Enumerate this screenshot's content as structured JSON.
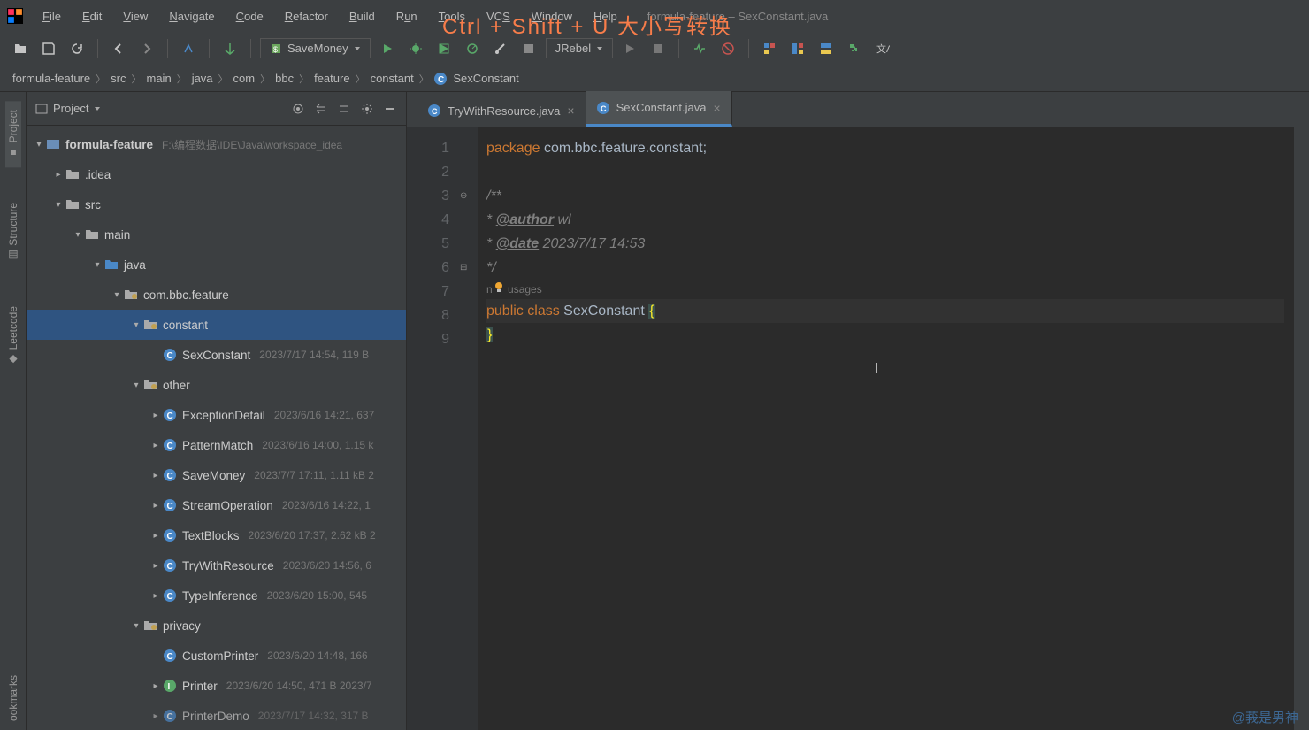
{
  "menu": [
    "File",
    "Edit",
    "View",
    "Navigate",
    "Code",
    "Refactor",
    "Build",
    "Run",
    "Tools",
    "VCS",
    "Window",
    "Help"
  ],
  "title_path": "formula-feature – SexConstant.java",
  "overlay": "Ctrl + Shift + U  大小写转换",
  "run_config": "SaveMoney",
  "jrebel": "JRebel",
  "breadcrumbs": [
    "formula-feature",
    "src",
    "main",
    "java",
    "com",
    "bbc",
    "feature",
    "constant",
    "SexConstant"
  ],
  "panel_name": "Project",
  "side_tabs": {
    "project": "Project",
    "structure": "Structure",
    "leetcode": "Leetcode",
    "bookmarks": "ookmarks"
  },
  "tree": {
    "root": {
      "name": "formula-feature",
      "meta": "F:\\编程数据\\IDE\\Java\\workspace_idea"
    },
    "idea": ".idea",
    "src": "src",
    "main": "main",
    "java": "java",
    "pkg": "com.bbc.feature",
    "constant": "constant",
    "sex": {
      "name": "SexConstant",
      "meta": "2023/7/17 14:54, 119 B"
    },
    "other": "other",
    "items": [
      {
        "name": "ExceptionDetail",
        "meta": "2023/6/16 14:21, 637"
      },
      {
        "name": "PatternMatch",
        "meta": "2023/6/16 14:00, 1.15 k"
      },
      {
        "name": "SaveMoney",
        "meta": "2023/7/7 17:11, 1.11 kB 2"
      },
      {
        "name": "StreamOperation",
        "meta": "2023/6/16 14:22, 1"
      },
      {
        "name": "TextBlocks",
        "meta": "2023/6/20 17:37, 2.62 kB 2"
      },
      {
        "name": "TryWithResource",
        "meta": "2023/6/20 14:56, 6"
      },
      {
        "name": "TypeInference",
        "meta": "2023/6/20 15:00, 545"
      }
    ],
    "privacy": "privacy",
    "custom_printer": {
      "name": "CustomPrinter",
      "meta": "2023/6/20 14:48, 166"
    },
    "printer": {
      "name": "Printer",
      "meta": "2023/6/20 14:50, 471 B 2023/7"
    },
    "printer_demo": {
      "name": "PrinterDemo",
      "meta": "2023/7/17 14:32, 317 B"
    }
  },
  "tabs": [
    {
      "name": "TryWithResource.java",
      "active": false
    },
    {
      "name": "SexConstant.java",
      "active": true
    }
  ],
  "line_numbers": [
    "1",
    "2",
    "3",
    "4",
    "5",
    "6",
    "",
    "7",
    "8",
    "9"
  ],
  "code": {
    "l1_kw": "package",
    "l1_pkg": " com.bbc.feature.constant;",
    "l3": "/**",
    "l4_pre": " * ",
    "l4_tag": "@author",
    "l4_rest": " wl",
    "l5_pre": " * ",
    "l5_tag": "@date",
    "l5_rest": " 2023/7/17 14:53",
    "l6": " */",
    "hint": "no usages",
    "l7_public": "public",
    "l7_class": "class",
    "l7_name": "SexConstant",
    "l7_brace": "{",
    "l8": "}"
  },
  "watermark": "@莪是男神"
}
